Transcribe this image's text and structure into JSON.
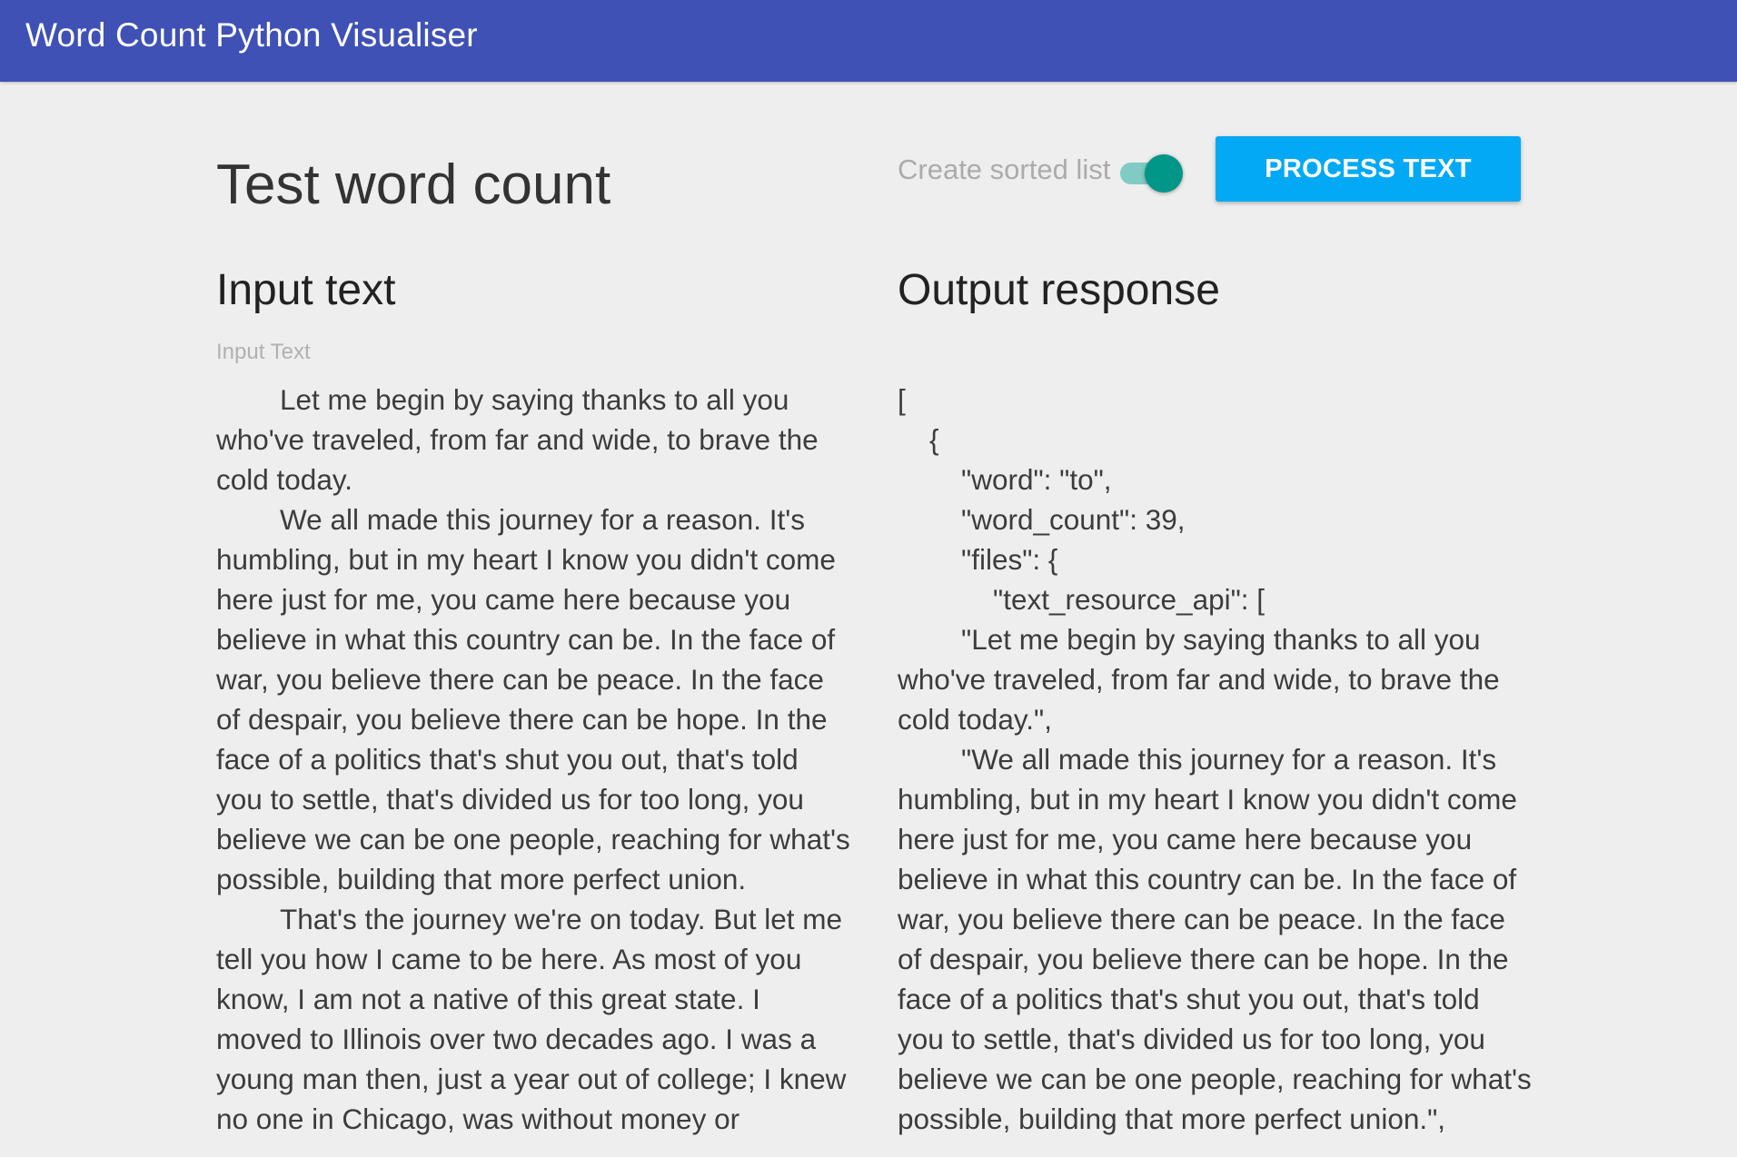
{
  "appbar": {
    "title": "Word Count Python Visualiser"
  },
  "page": {
    "title": "Test word count"
  },
  "controls": {
    "toggle_label": "Create sorted list",
    "toggle_on": true,
    "process_button": "PROCESS TEXT"
  },
  "input": {
    "section_title": "Input text",
    "field_label": "Input Text",
    "value": "\t\tLet me begin by saying thanks to all you who've traveled, from far and wide, to brave the cold today.\n\t\tWe all made this journey for a reason. It's humbling, but in my heart I know you didn't come here just for me, you came here because you believe in what this country can be. In the face of war, you believe there can be peace. In the face of despair, you believe there can be hope. In the face of a politics that's shut you out, that's told you to settle, that's divided us for too long, you believe we can be one people, reaching for what's possible, building that more perfect union.\n\t\tThat's the journey we're on today. But let me tell you how I came to be here. As most of you know, I am not a native of this great state. I moved to Illinois over two decades ago. I was a young man then, just a year out of college; I knew no one in Chicago, was without money or"
  },
  "output": {
    "section_title": "Output response",
    "value": "[\n    {\n        \"word\": \"to\",\n        \"word_count\": 39,\n        \"files\": {\n            \"text_resource_api\": [\n\t\t\"Let me begin by saying thanks to all you who've traveled, from far and wide, to brave the cold today.\",\n\t\t\"We all made this journey for a reason. It's humbling, but in my heart I know you didn't come here just for me, you came here because you believe in what this country can be. In the face of war, you believe there can be peace. In the face of despair, you believe there can be hope. In the face of a politics that's shut you out, that's told you to settle, that's divided us for too long, you believe we can be one people, reaching for what's possible, building that more perfect union.\","
  },
  "colors": {
    "appbar": "#3f51b5",
    "background": "#eeeeee",
    "button": "#03a9f4",
    "toggle_thumb": "#009688",
    "toggle_track": "#80cbc4"
  }
}
